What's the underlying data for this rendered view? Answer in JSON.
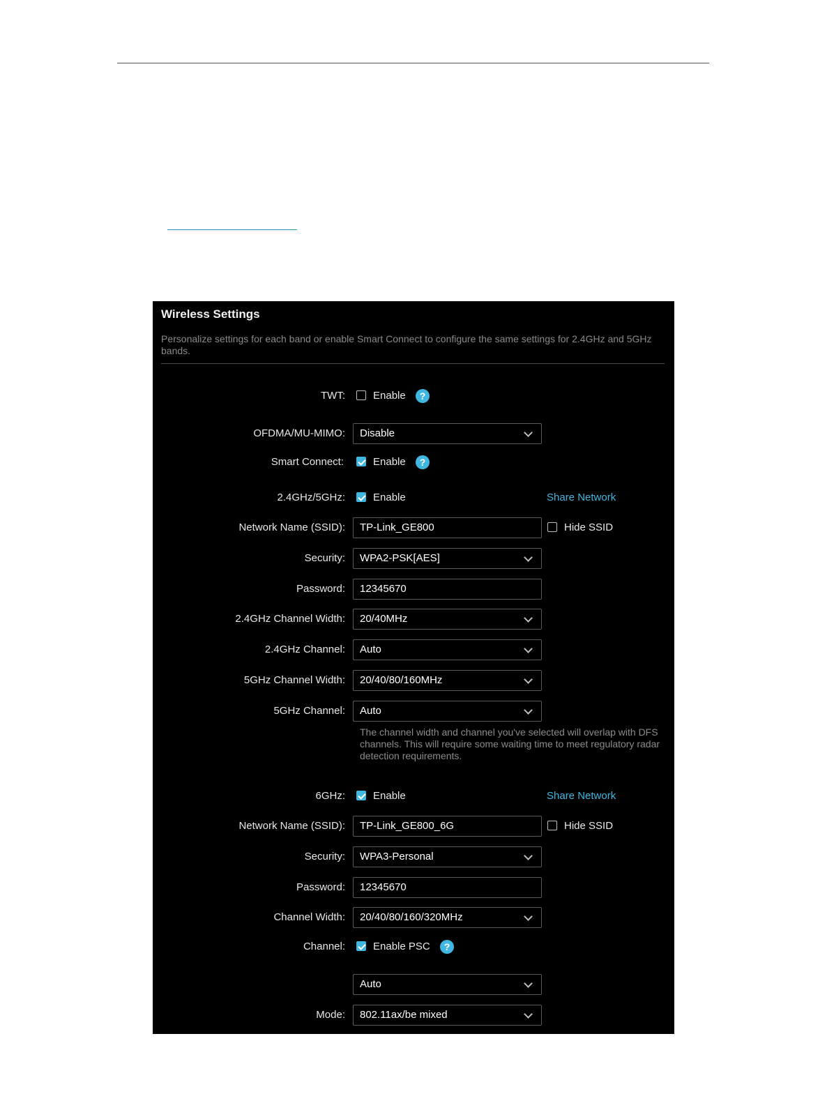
{
  "panel": {
    "title": "Wireless Settings",
    "description": "Personalize settings for each band or enable Smart Connect to configure the same settings for 2.4GHz and 5GHz bands."
  },
  "twt": {
    "label": "TWT:",
    "checkbox_label": "Enable",
    "checked": false
  },
  "ofdma": {
    "label": "OFDMA/MU-MIMO:",
    "value": "Disable"
  },
  "smart_connect": {
    "label": "Smart Connect:",
    "checkbox_label": "Enable",
    "checked": true
  },
  "band_24_5": {
    "label": "2.4GHz/5GHz:",
    "checkbox_label": "Enable",
    "checked": true,
    "share_label": "Share Network",
    "ssid_label": "Network Name (SSID):",
    "ssid_value": "TP-Link_GE800",
    "hide_ssid_label": "Hide SSID",
    "security_label": "Security:",
    "security_value": "WPA2-PSK[AES]",
    "password_label": "Password:",
    "password_value": "12345670",
    "ch_width_24_label": "2.4GHz Channel Width:",
    "ch_width_24_value": "20/40MHz",
    "channel_24_label": "2.4GHz Channel:",
    "channel_24_value": "Auto",
    "ch_width_5_label": "5GHz Channel Width:",
    "ch_width_5_value": "20/40/80/160MHz",
    "channel_5_label": "5GHz Channel:",
    "channel_5_value": "Auto",
    "dfs_note": "The channel width and channel you've selected will overlap with DFS channels. This will require some waiting time to meet regulatory radar detection requirements."
  },
  "band_6": {
    "label": "6GHz:",
    "checkbox_label": "Enable",
    "checked": true,
    "share_label": "Share Network",
    "ssid_label": "Network Name (SSID):",
    "ssid_value": "TP-Link_GE800_6G",
    "hide_ssid_label": "Hide SSID",
    "security_label": "Security:",
    "security_value": "WPA3-Personal",
    "password_label": "Password:",
    "password_value": "12345670",
    "ch_width_label": "Channel Width:",
    "ch_width_value": "20/40/80/160/320MHz",
    "channel_label": "Channel:",
    "psc_label": "Enable PSC",
    "psc_checked": true,
    "channel_value": "Auto",
    "mode_label": "Mode:",
    "mode_value": "802.11ax/be mixed"
  },
  "help_glyph": "?",
  "colors": {
    "accent": "#3fb7e0",
    "panel_bg": "#000000",
    "muted_text": "#8a8a8a"
  }
}
